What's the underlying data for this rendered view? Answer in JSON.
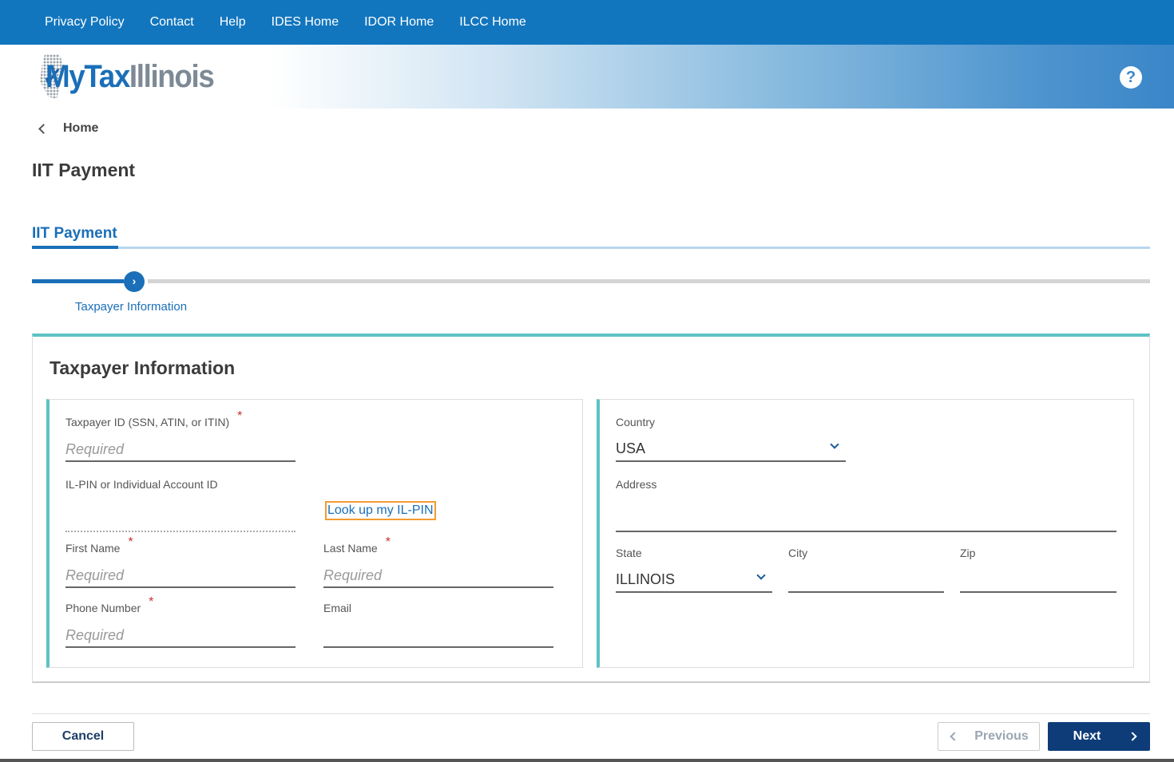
{
  "topnav": {
    "items": [
      "Privacy Policy",
      "Contact",
      "Help",
      "IDES Home",
      "IDOR Home",
      "ILCC Home"
    ]
  },
  "header": {
    "logo": "MyTax Illinois",
    "help_icon": "question-circle-icon"
  },
  "breadcrumb": {
    "label": "Home"
  },
  "page": {
    "title": "IIT Payment"
  },
  "tabs": {
    "active": "IIT Payment"
  },
  "progress": {
    "step_label": "Taxpayer Information",
    "current_step": 1
  },
  "form": {
    "title": "Taxpayer Information",
    "taxpayer_id": {
      "label": "Taxpayer ID (SSN, ATIN, or ITIN)",
      "placeholder": "Required",
      "required": "*"
    },
    "ilpin": {
      "label": "IL-PIN or Individual Account ID",
      "link": "Look up my IL-PIN"
    },
    "first_name": {
      "label": "First Name",
      "placeholder": "Required",
      "required": "*"
    },
    "last_name": {
      "label": "Last Name",
      "placeholder": "Required",
      "required": "*"
    },
    "phone": {
      "label": "Phone Number",
      "placeholder": "Required",
      "required": "*"
    },
    "email": {
      "label": "Email"
    },
    "country": {
      "label": "Country",
      "value": "USA"
    },
    "address": {
      "label": "Address"
    },
    "state": {
      "label": "State",
      "value": "ILLINOIS"
    },
    "city": {
      "label": "City"
    },
    "zip": {
      "label": "Zip"
    }
  },
  "footer": {
    "cancel": "Cancel",
    "previous": "Previous",
    "next": "Next"
  },
  "colors": {
    "nav_blue": "#1276be",
    "accent_teal": "#5ec2c4",
    "link_blue": "#1a6fb8",
    "next_navy": "#0d3c78",
    "required_red": "#c9302c",
    "focus_orange": "#f39b30"
  }
}
